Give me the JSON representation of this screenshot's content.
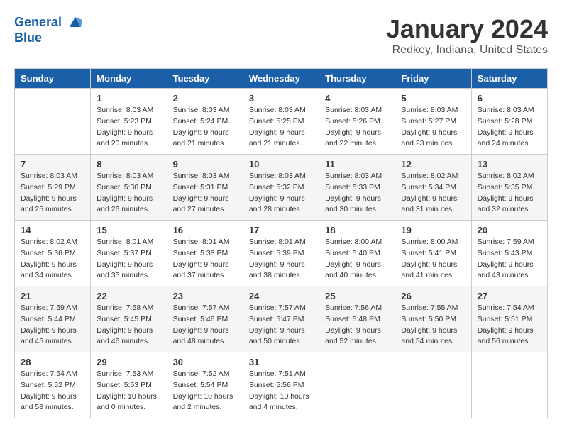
{
  "header": {
    "logo_line1": "General",
    "logo_line2": "Blue",
    "month_title": "January 2024",
    "location": "Redkey, Indiana, United States"
  },
  "days_of_week": [
    "Sunday",
    "Monday",
    "Tuesday",
    "Wednesday",
    "Thursday",
    "Friday",
    "Saturday"
  ],
  "weeks": [
    [
      {
        "day": "",
        "info": ""
      },
      {
        "day": "1",
        "info": "Sunrise: 8:03 AM\nSunset: 5:23 PM\nDaylight: 9 hours\nand 20 minutes."
      },
      {
        "day": "2",
        "info": "Sunrise: 8:03 AM\nSunset: 5:24 PM\nDaylight: 9 hours\nand 21 minutes."
      },
      {
        "day": "3",
        "info": "Sunrise: 8:03 AM\nSunset: 5:25 PM\nDaylight: 9 hours\nand 21 minutes."
      },
      {
        "day": "4",
        "info": "Sunrise: 8:03 AM\nSunset: 5:26 PM\nDaylight: 9 hours\nand 22 minutes."
      },
      {
        "day": "5",
        "info": "Sunrise: 8:03 AM\nSunset: 5:27 PM\nDaylight: 9 hours\nand 23 minutes."
      },
      {
        "day": "6",
        "info": "Sunrise: 8:03 AM\nSunset: 5:28 PM\nDaylight: 9 hours\nand 24 minutes."
      }
    ],
    [
      {
        "day": "7",
        "info": "Sunrise: 8:03 AM\nSunset: 5:29 PM\nDaylight: 9 hours\nand 25 minutes."
      },
      {
        "day": "8",
        "info": "Sunrise: 8:03 AM\nSunset: 5:30 PM\nDaylight: 9 hours\nand 26 minutes."
      },
      {
        "day": "9",
        "info": "Sunrise: 8:03 AM\nSunset: 5:31 PM\nDaylight: 9 hours\nand 27 minutes."
      },
      {
        "day": "10",
        "info": "Sunrise: 8:03 AM\nSunset: 5:32 PM\nDaylight: 9 hours\nand 28 minutes."
      },
      {
        "day": "11",
        "info": "Sunrise: 8:03 AM\nSunset: 5:33 PM\nDaylight: 9 hours\nand 30 minutes."
      },
      {
        "day": "12",
        "info": "Sunrise: 8:02 AM\nSunset: 5:34 PM\nDaylight: 9 hours\nand 31 minutes."
      },
      {
        "day": "13",
        "info": "Sunrise: 8:02 AM\nSunset: 5:35 PM\nDaylight: 9 hours\nand 32 minutes."
      }
    ],
    [
      {
        "day": "14",
        "info": "Sunrise: 8:02 AM\nSunset: 5:36 PM\nDaylight: 9 hours\nand 34 minutes."
      },
      {
        "day": "15",
        "info": "Sunrise: 8:01 AM\nSunset: 5:37 PM\nDaylight: 9 hours\nand 35 minutes."
      },
      {
        "day": "16",
        "info": "Sunrise: 8:01 AM\nSunset: 5:38 PM\nDaylight: 9 hours\nand 37 minutes."
      },
      {
        "day": "17",
        "info": "Sunrise: 8:01 AM\nSunset: 5:39 PM\nDaylight: 9 hours\nand 38 minutes."
      },
      {
        "day": "18",
        "info": "Sunrise: 8:00 AM\nSunset: 5:40 PM\nDaylight: 9 hours\nand 40 minutes."
      },
      {
        "day": "19",
        "info": "Sunrise: 8:00 AM\nSunset: 5:41 PM\nDaylight: 9 hours\nand 41 minutes."
      },
      {
        "day": "20",
        "info": "Sunrise: 7:59 AM\nSunset: 5:43 PM\nDaylight: 9 hours\nand 43 minutes."
      }
    ],
    [
      {
        "day": "21",
        "info": "Sunrise: 7:59 AM\nSunset: 5:44 PM\nDaylight: 9 hours\nand 45 minutes."
      },
      {
        "day": "22",
        "info": "Sunrise: 7:58 AM\nSunset: 5:45 PM\nDaylight: 9 hours\nand 46 minutes."
      },
      {
        "day": "23",
        "info": "Sunrise: 7:57 AM\nSunset: 5:46 PM\nDaylight: 9 hours\nand 48 minutes."
      },
      {
        "day": "24",
        "info": "Sunrise: 7:57 AM\nSunset: 5:47 PM\nDaylight: 9 hours\nand 50 minutes."
      },
      {
        "day": "25",
        "info": "Sunrise: 7:56 AM\nSunset: 5:48 PM\nDaylight: 9 hours\nand 52 minutes."
      },
      {
        "day": "26",
        "info": "Sunrise: 7:55 AM\nSunset: 5:50 PM\nDaylight: 9 hours\nand 54 minutes."
      },
      {
        "day": "27",
        "info": "Sunrise: 7:54 AM\nSunset: 5:51 PM\nDaylight: 9 hours\nand 56 minutes."
      }
    ],
    [
      {
        "day": "28",
        "info": "Sunrise: 7:54 AM\nSunset: 5:52 PM\nDaylight: 9 hours\nand 58 minutes."
      },
      {
        "day": "29",
        "info": "Sunrise: 7:53 AM\nSunset: 5:53 PM\nDaylight: 10 hours\nand 0 minutes."
      },
      {
        "day": "30",
        "info": "Sunrise: 7:52 AM\nSunset: 5:54 PM\nDaylight: 10 hours\nand 2 minutes."
      },
      {
        "day": "31",
        "info": "Sunrise: 7:51 AM\nSunset: 5:56 PM\nDaylight: 10 hours\nand 4 minutes."
      },
      {
        "day": "",
        "info": ""
      },
      {
        "day": "",
        "info": ""
      },
      {
        "day": "",
        "info": ""
      }
    ]
  ]
}
